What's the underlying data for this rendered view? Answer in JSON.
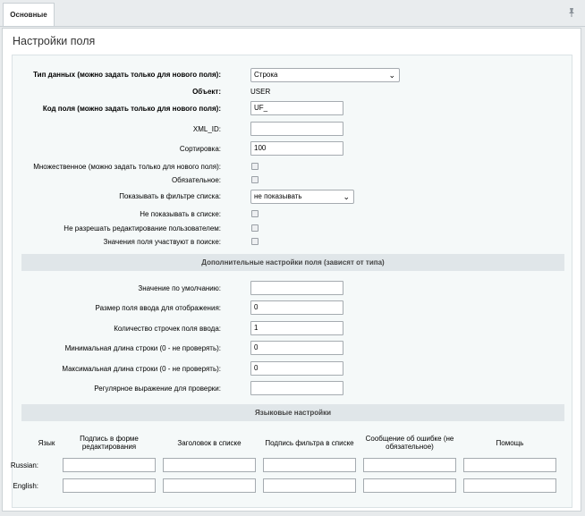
{
  "tabs": {
    "main_label": "Основные"
  },
  "title": "Настройки поля",
  "fields": {
    "data_type": {
      "label": "Тип данных (можно задать только для нового поля):",
      "value": "Строка"
    },
    "object": {
      "label": "Объект:",
      "value": "USER"
    },
    "code": {
      "label": "Код поля (можно задать только для нового поля):",
      "value": "UF_"
    },
    "xml_id": {
      "label": "XML_ID:",
      "value": ""
    },
    "sort": {
      "label": "Сортировка:",
      "value": "100"
    },
    "multiple": {
      "label": "Множественное (можно задать только для нового поля):",
      "checked": false
    },
    "mandatory": {
      "label": "Обязательное:",
      "checked": false
    },
    "show_filter": {
      "label": "Показывать в фильтре списка:",
      "value": "не показывать"
    },
    "hide_in_list": {
      "label": "Не показывать в списке:",
      "checked": false
    },
    "no_edit": {
      "label": "Не разрешать редактирование пользователем:",
      "checked": false
    },
    "in_search": {
      "label": "Значения поля участвуют в поиске:",
      "checked": false
    }
  },
  "extra": {
    "heading": "Дополнительные настройки поля (зависят от типа)",
    "default_value": {
      "label": "Значение по умолчанию:",
      "value": ""
    },
    "size": {
      "label": "Размер поля ввода для отображения:",
      "value": "0"
    },
    "rows": {
      "label": "Количество строчек поля ввода:",
      "value": "1"
    },
    "min_length": {
      "label": "Минимальная длина строки (0 - не проверять):",
      "value": "0"
    },
    "max_length": {
      "label": "Максимальная длина строки (0 - не проверять):",
      "value": "0"
    },
    "regexp": {
      "label": "Регулярное выражение для проверки:",
      "value": ""
    }
  },
  "lang": {
    "heading": "Языковые настройки",
    "columns": [
      "Язык",
      "Подпись в форме редактирования",
      "Заголовок в списке",
      "Подпись фильтра в списке",
      "Сообщение об ошибке (не обязательное)",
      "Помощь"
    ],
    "rows": [
      "Russian:",
      "English:"
    ]
  },
  "icons": {
    "pin": "pin-icon",
    "select_arrow": "chevron-down-icon"
  }
}
